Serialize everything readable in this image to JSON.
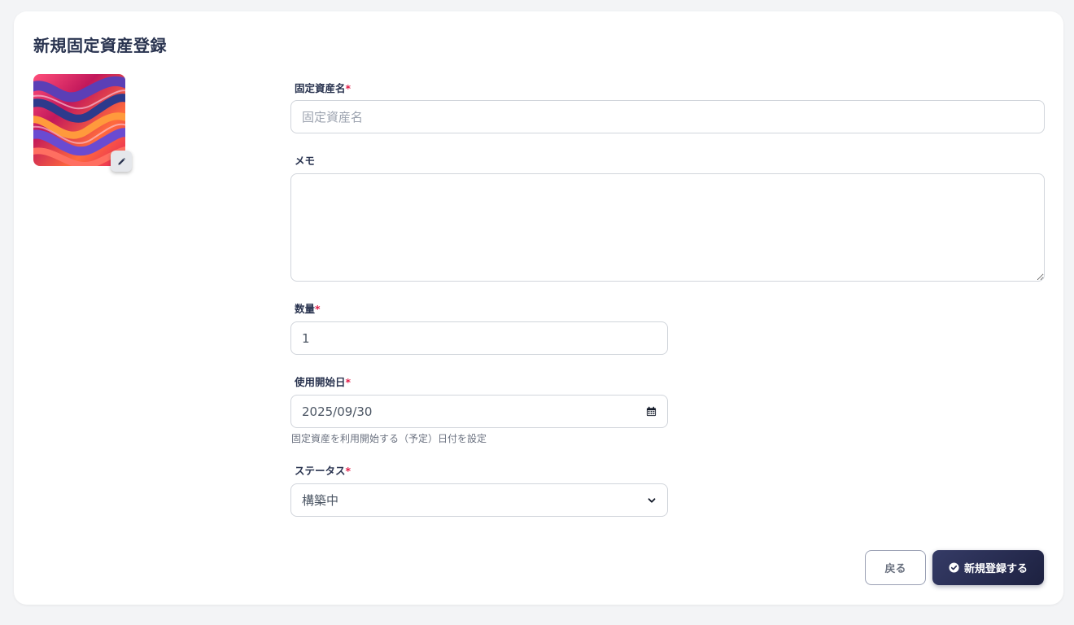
{
  "page": {
    "title": "新規固定資産登録"
  },
  "image": {
    "edit_icon": "pencil-icon"
  },
  "form": {
    "name": {
      "label": "固定資産名",
      "required_mark": "*",
      "placeholder": "固定資産名",
      "value": ""
    },
    "memo": {
      "label": "メモ",
      "value": ""
    },
    "quantity": {
      "label": "数量",
      "required_mark": "*",
      "value": "1"
    },
    "start_date": {
      "label": "使用開始日",
      "required_mark": "*",
      "value": "2025/09/30",
      "hint": "固定資産を利用開始する（予定）日付を設定",
      "icon": "calendar-icon"
    },
    "status": {
      "label": "ステータス",
      "required_mark": "*",
      "value": "構築中",
      "icon": "chevron-down-icon"
    }
  },
  "actions": {
    "back_label": "戻る",
    "submit_label": "新規登録する",
    "submit_icon": "check-circle-icon",
    "primary_color": "#262b50"
  }
}
